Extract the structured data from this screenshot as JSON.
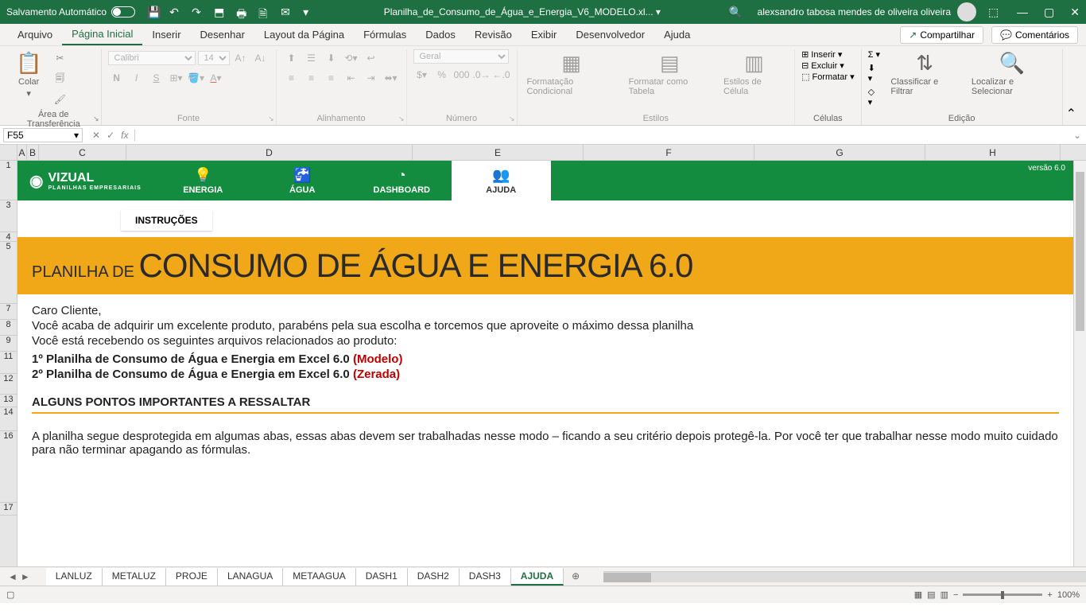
{
  "titlebar": {
    "autosave": "Salvamento Automático",
    "filename": "Planilha_de_Consumo_de_Água_e_Energia_V6_MODELO.xl...",
    "username": "alexsandro tabosa mendes de oliveira oliveira"
  },
  "ribbon_tabs": {
    "arquivo": "Arquivo",
    "pagina_inicial": "Página Inicial",
    "inserir": "Inserir",
    "desenhar": "Desenhar",
    "layout": "Layout da Página",
    "formulas": "Fórmulas",
    "dados": "Dados",
    "revisao": "Revisão",
    "exibir": "Exibir",
    "desenvolvedor": "Desenvolvedor",
    "ajuda": "Ajuda",
    "compartilhar": "Compartilhar",
    "comentarios": "Comentários"
  },
  "ribbon": {
    "clipboard": {
      "label": "Área de Transferência",
      "paste": "Colar"
    },
    "font": {
      "label": "Fonte",
      "name": "Calibri",
      "size": "14"
    },
    "alignment": {
      "label": "Alinhamento"
    },
    "number": {
      "label": "Número",
      "format": "Geral"
    },
    "styles": {
      "label": "Estilos",
      "cond": "Formatação Condicional",
      "table": "Formatar como Tabela",
      "cell": "Estilos de Célula"
    },
    "cells": {
      "label": "Células",
      "insert": "Inserir",
      "delete": "Excluir",
      "format": "Formatar"
    },
    "editing": {
      "label": "Edição",
      "sort": "Classificar e Filtrar",
      "find": "Localizar e Selecionar"
    }
  },
  "name_box": "F55",
  "columns": [
    "A",
    "B",
    "C",
    "D",
    "E",
    "F",
    "G",
    "H"
  ],
  "rows": [
    "1",
    "3",
    "4",
    "5",
    "7",
    "8",
    "9",
    "11",
    "12",
    "13",
    "14",
    "16",
    "17"
  ],
  "nav": {
    "brand": "VIZUAL",
    "brand_sub": "PLANILHAS EMPRESARIAIS",
    "energia": "ENERGIA",
    "agua": "ÁGUA",
    "dashboard": "DASHBOARD",
    "ajuda": "AJUDA",
    "version": "versão 6.0",
    "instrucoes": "INSTRUÇÕES"
  },
  "banner": {
    "prefix": "PLANILHA DE ",
    "title": "CONSUMO DE ÁGUA E ENERGIA 6.0"
  },
  "content": {
    "greeting": "Caro Cliente,",
    "line1": "Você acaba de adquirir um excelente produto, parabéns pela sua escolha e torcemos que aproveite o máximo dessa planilha",
    "line2": "Você está recebendo os seguintes arquivos relacionados ao produto:",
    "item1_prefix": "1º Planilha de Consumo de Água e Energia em Excel 6.0 ",
    "item1_tag": "(Modelo)",
    "item2_prefix": "2º Planilha de Consumo de Água e Energia em Excel 6.0 ",
    "item2_tag": "(Zerada)",
    "section": "ALGUNS PONTOS IMPORTANTES A RESSALTAR",
    "para": "A planilha  segue desprotegida em algumas abas, essas abas devem ser trabalhadas nesse modo – ficando a seu critério depois protegê-la. Por você ter que trabalhar nesse modo muito cuidado para não terminar apagando as fórmulas."
  },
  "sheet_tabs": [
    "LANLUZ",
    "METALUZ",
    "PROJE",
    "LANAGUA",
    "METAAGUA",
    "DASH1",
    "DASH2",
    "DASH3",
    "AJUDA"
  ],
  "status": {
    "zoom": "100%"
  }
}
